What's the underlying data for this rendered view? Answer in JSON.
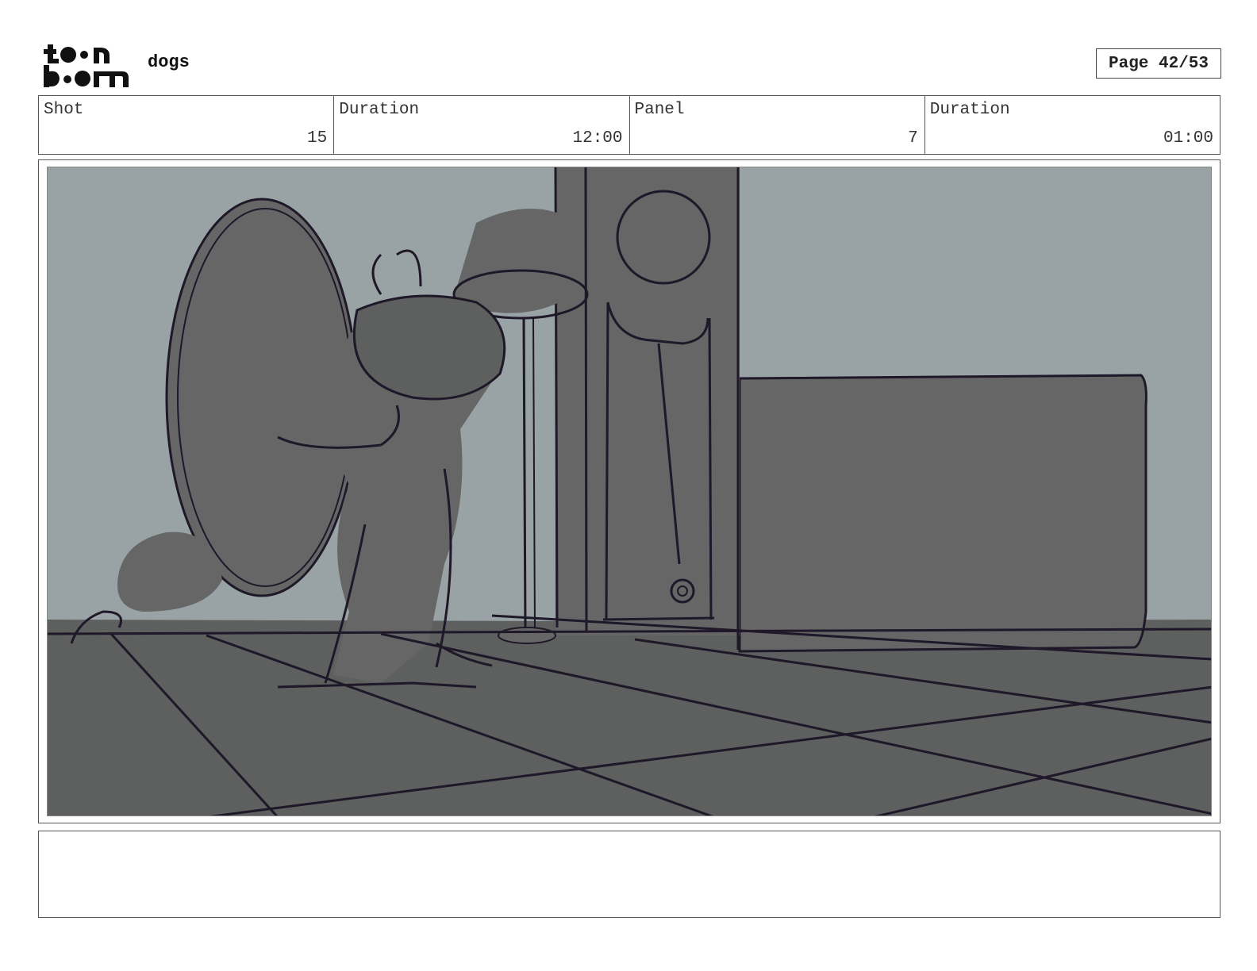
{
  "header": {
    "logo_text": "toon boom",
    "project": "dogs",
    "page": "Page 42/53"
  },
  "info": {
    "shot_label": "Shot",
    "shot_value": "15",
    "duration_label": "Duration",
    "duration_value": "12:00",
    "panel_label": "Panel",
    "panel_value": "7",
    "panel_duration_label": "Duration",
    "panel_duration_value": "01:00"
  },
  "notes": {
    "text": ""
  },
  "colors": {
    "wall": "#99a3a5",
    "floor": "#5e5f5f",
    "object": "#666667",
    "ink": "#1e1828"
  }
}
